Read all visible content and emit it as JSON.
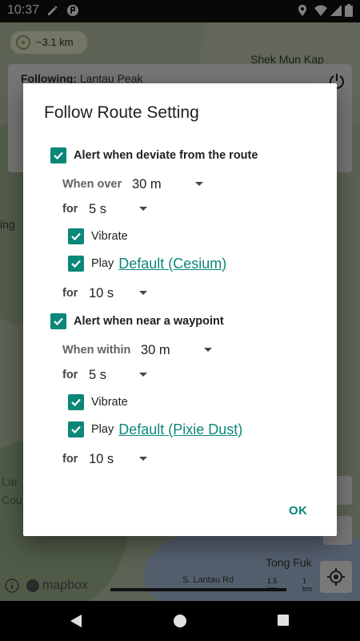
{
  "status_bar": {
    "time": "10:37",
    "left_icons": [
      "pencil-icon",
      "app-badge-icon"
    ],
    "right_icons": [
      "location-icon",
      "wifi-icon",
      "signal-icon",
      "battery-icon"
    ]
  },
  "map": {
    "scale": "~3.1 km",
    "following_label": "Following:",
    "following_value": "Lantau Peak",
    "place_labels": [
      "Shek Mun Kap",
      "Tong Fuk",
      "S. Lantau Rd",
      "Lar",
      "Cou",
      "ing"
    ],
    "attribution": "mapbox",
    "scale_bar": [
      "1 km",
      "1.5 km"
    ]
  },
  "dialog": {
    "title": "Follow Route Setting",
    "deviate": {
      "checked": true,
      "label": "Alert when deviate from the route",
      "distance_label": "When over",
      "distance_value": "30 m",
      "duration_label": "for",
      "duration_value": "5 s",
      "vibrate_label": "Vibrate",
      "vibrate_checked": true,
      "play_label": "Play",
      "play_checked": true,
      "sound": "Default (Cesium)",
      "repeat_label": "for",
      "repeat_value": "10 s"
    },
    "waypoint": {
      "checked": true,
      "label": "Alert when near a waypoint",
      "distance_label": "When within",
      "distance_value": "30 m",
      "duration_label": "for",
      "duration_value": "5 s",
      "vibrate_label": "Vibrate",
      "vibrate_checked": true,
      "play_label": "Play",
      "play_checked": true,
      "sound": "Default (Pixie Dust)",
      "repeat_label": "for",
      "repeat_value": "10 s"
    },
    "ok_label": "OK"
  },
  "colors": {
    "accent": "#0b8778",
    "dialog_bg": "#ffffff",
    "scrim": "rgba(0,0,0,0.5)"
  },
  "nav_bar": {
    "buttons": [
      "back-icon",
      "home-icon",
      "recents-icon"
    ]
  }
}
